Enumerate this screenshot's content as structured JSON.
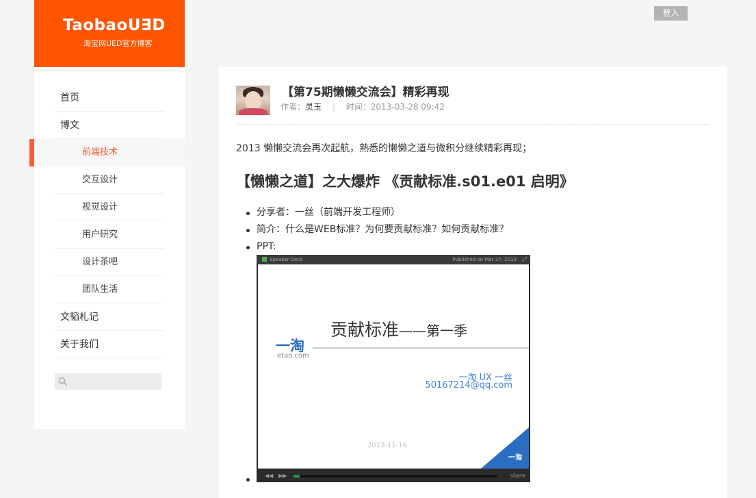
{
  "header": {
    "login_label": "登入"
  },
  "brand": {
    "title": "TaobaoU∃D",
    "subtitle": "淘宝网UED官方博客",
    "color": "#ff5500"
  },
  "nav": {
    "items": [
      {
        "label": "首页"
      },
      {
        "label": "博文"
      },
      {
        "label": "前端技术",
        "active": true
      },
      {
        "label": "交互设计"
      },
      {
        "label": "视觉设计"
      },
      {
        "label": "用户研究"
      },
      {
        "label": "设计茶吧"
      },
      {
        "label": "团队生活"
      },
      {
        "label": "文韬札记"
      },
      {
        "label": "关于我们"
      }
    ],
    "active_color": "#ff5a36"
  },
  "search": {
    "icon": "search-icon",
    "placeholder": ""
  },
  "post": {
    "title": "【第75期懒懒交流会】精彩再现",
    "author_prefix": "作者：",
    "author": "灵玉",
    "time_prefix": "时间：",
    "time": "2013-03-28 09:42",
    "intro": "2013 懒懒交流会再次起航，熟悉的懒懒之道与微积分继续精彩再现；",
    "section_title": "【懒懒之道】之大爆炸 《贡献标准.s01.e01 启明》",
    "list": [
      "分享者：一丝（前端开发工程师）",
      "简介：什么是WEB标准？为何要贡献标准？如何贡献标准？",
      "PPT:"
    ]
  },
  "deck": {
    "brand": "Speaker Deck",
    "published": "Published on Mar 27, 2013",
    "expand_icon": "⤢",
    "slide_title_main": "贡献标准",
    "slide_title_tail": "——第一季",
    "logo_cn": "一淘",
    "logo_en": "etao.com",
    "author_line1": "一淘 UX  一丝",
    "author_line2": "50167214@qq.com",
    "slide_date": "2012-11-16",
    "corner_logo": "一淘",
    "prev_icon": "◀◀",
    "next_icon": "▶▶",
    "share_label": "share",
    "progress": 0.03
  }
}
